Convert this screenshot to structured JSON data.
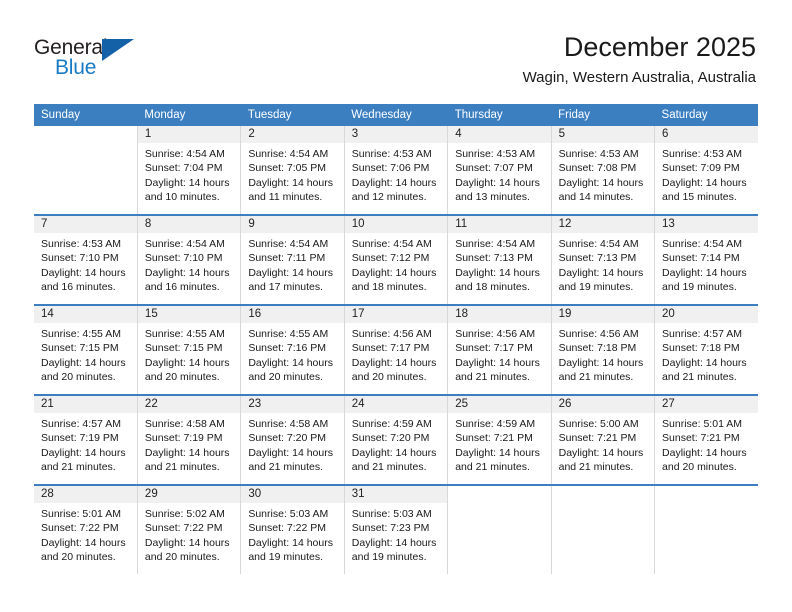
{
  "brand": {
    "name_part1": "General",
    "name_part2": "Blue",
    "accent_color": "#1461a8",
    "text_color": "#231f20"
  },
  "header": {
    "title": "December 2025",
    "subtitle": "Wagin, Western Australia, Australia"
  },
  "theme": {
    "header_row_bg": "#3c7fc1",
    "daynum_band_bg": "#f0f0f0",
    "cell_border": "#d8d8d8"
  },
  "weekday_headers": [
    "Sunday",
    "Monday",
    "Tuesday",
    "Wednesday",
    "Thursday",
    "Friday",
    "Saturday"
  ],
  "labels": {
    "sunrise_prefix": "Sunrise: ",
    "sunset_prefix": "Sunset: ",
    "daylight_prefix": "Daylight: "
  },
  "weeks": [
    [
      {
        "day": "",
        "sunrise": "",
        "sunset": "",
        "daylight": "",
        "blank": true
      },
      {
        "day": "1",
        "sunrise": "Sunrise: 4:54 AM",
        "sunset": "Sunset: 7:04 PM",
        "daylight": "Daylight: 14 hours and 10 minutes."
      },
      {
        "day": "2",
        "sunrise": "Sunrise: 4:54 AM",
        "sunset": "Sunset: 7:05 PM",
        "daylight": "Daylight: 14 hours and 11 minutes."
      },
      {
        "day": "3",
        "sunrise": "Sunrise: 4:53 AM",
        "sunset": "Sunset: 7:06 PM",
        "daylight": "Daylight: 14 hours and 12 minutes."
      },
      {
        "day": "4",
        "sunrise": "Sunrise: 4:53 AM",
        "sunset": "Sunset: 7:07 PM",
        "daylight": "Daylight: 14 hours and 13 minutes."
      },
      {
        "day": "5",
        "sunrise": "Sunrise: 4:53 AM",
        "sunset": "Sunset: 7:08 PM",
        "daylight": "Daylight: 14 hours and 14 minutes."
      },
      {
        "day": "6",
        "sunrise": "Sunrise: 4:53 AM",
        "sunset": "Sunset: 7:09 PM",
        "daylight": "Daylight: 14 hours and 15 minutes."
      }
    ],
    [
      {
        "day": "7",
        "sunrise": "Sunrise: 4:53 AM",
        "sunset": "Sunset: 7:10 PM",
        "daylight": "Daylight: 14 hours and 16 minutes."
      },
      {
        "day": "8",
        "sunrise": "Sunrise: 4:54 AM",
        "sunset": "Sunset: 7:10 PM",
        "daylight": "Daylight: 14 hours and 16 minutes."
      },
      {
        "day": "9",
        "sunrise": "Sunrise: 4:54 AM",
        "sunset": "Sunset: 7:11 PM",
        "daylight": "Daylight: 14 hours and 17 minutes."
      },
      {
        "day": "10",
        "sunrise": "Sunrise: 4:54 AM",
        "sunset": "Sunset: 7:12 PM",
        "daylight": "Daylight: 14 hours and 18 minutes."
      },
      {
        "day": "11",
        "sunrise": "Sunrise: 4:54 AM",
        "sunset": "Sunset: 7:13 PM",
        "daylight": "Daylight: 14 hours and 18 minutes."
      },
      {
        "day": "12",
        "sunrise": "Sunrise: 4:54 AM",
        "sunset": "Sunset: 7:13 PM",
        "daylight": "Daylight: 14 hours and 19 minutes."
      },
      {
        "day": "13",
        "sunrise": "Sunrise: 4:54 AM",
        "sunset": "Sunset: 7:14 PM",
        "daylight": "Daylight: 14 hours and 19 minutes."
      }
    ],
    [
      {
        "day": "14",
        "sunrise": "Sunrise: 4:55 AM",
        "sunset": "Sunset: 7:15 PM",
        "daylight": "Daylight: 14 hours and 20 minutes."
      },
      {
        "day": "15",
        "sunrise": "Sunrise: 4:55 AM",
        "sunset": "Sunset: 7:15 PM",
        "daylight": "Daylight: 14 hours and 20 minutes."
      },
      {
        "day": "16",
        "sunrise": "Sunrise: 4:55 AM",
        "sunset": "Sunset: 7:16 PM",
        "daylight": "Daylight: 14 hours and 20 minutes."
      },
      {
        "day": "17",
        "sunrise": "Sunrise: 4:56 AM",
        "sunset": "Sunset: 7:17 PM",
        "daylight": "Daylight: 14 hours and 20 minutes."
      },
      {
        "day": "18",
        "sunrise": "Sunrise: 4:56 AM",
        "sunset": "Sunset: 7:17 PM",
        "daylight": "Daylight: 14 hours and 21 minutes."
      },
      {
        "day": "19",
        "sunrise": "Sunrise: 4:56 AM",
        "sunset": "Sunset: 7:18 PM",
        "daylight": "Daylight: 14 hours and 21 minutes."
      },
      {
        "day": "20",
        "sunrise": "Sunrise: 4:57 AM",
        "sunset": "Sunset: 7:18 PM",
        "daylight": "Daylight: 14 hours and 21 minutes."
      }
    ],
    [
      {
        "day": "21",
        "sunrise": "Sunrise: 4:57 AM",
        "sunset": "Sunset: 7:19 PM",
        "daylight": "Daylight: 14 hours and 21 minutes."
      },
      {
        "day": "22",
        "sunrise": "Sunrise: 4:58 AM",
        "sunset": "Sunset: 7:19 PM",
        "daylight": "Daylight: 14 hours and 21 minutes."
      },
      {
        "day": "23",
        "sunrise": "Sunrise: 4:58 AM",
        "sunset": "Sunset: 7:20 PM",
        "daylight": "Daylight: 14 hours and 21 minutes."
      },
      {
        "day": "24",
        "sunrise": "Sunrise: 4:59 AM",
        "sunset": "Sunset: 7:20 PM",
        "daylight": "Daylight: 14 hours and 21 minutes."
      },
      {
        "day": "25",
        "sunrise": "Sunrise: 4:59 AM",
        "sunset": "Sunset: 7:21 PM",
        "daylight": "Daylight: 14 hours and 21 minutes."
      },
      {
        "day": "26",
        "sunrise": "Sunrise: 5:00 AM",
        "sunset": "Sunset: 7:21 PM",
        "daylight": "Daylight: 14 hours and 21 minutes."
      },
      {
        "day": "27",
        "sunrise": "Sunrise: 5:01 AM",
        "sunset": "Sunset: 7:21 PM",
        "daylight": "Daylight: 14 hours and 20 minutes."
      }
    ],
    [
      {
        "day": "28",
        "sunrise": "Sunrise: 5:01 AM",
        "sunset": "Sunset: 7:22 PM",
        "daylight": "Daylight: 14 hours and 20 minutes."
      },
      {
        "day": "29",
        "sunrise": "Sunrise: 5:02 AM",
        "sunset": "Sunset: 7:22 PM",
        "daylight": "Daylight: 14 hours and 20 minutes."
      },
      {
        "day": "30",
        "sunrise": "Sunrise: 5:03 AM",
        "sunset": "Sunset: 7:22 PM",
        "daylight": "Daylight: 14 hours and 19 minutes."
      },
      {
        "day": "31",
        "sunrise": "Sunrise: 5:03 AM",
        "sunset": "Sunset: 7:23 PM",
        "daylight": "Daylight: 14 hours and 19 minutes."
      },
      {
        "day": "",
        "sunrise": "",
        "sunset": "",
        "daylight": "",
        "blank": true
      },
      {
        "day": "",
        "sunrise": "",
        "sunset": "",
        "daylight": "",
        "blank": true
      },
      {
        "day": "",
        "sunrise": "",
        "sunset": "",
        "daylight": "",
        "blank": true
      }
    ]
  ]
}
